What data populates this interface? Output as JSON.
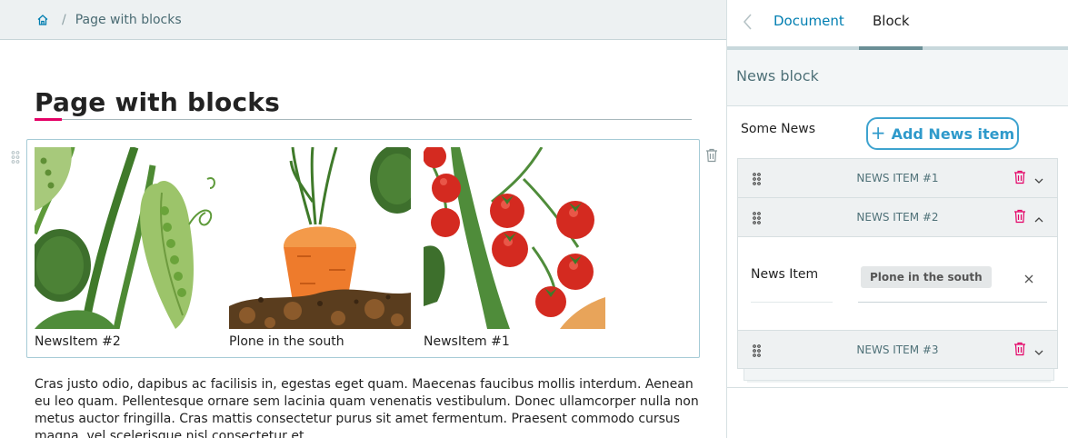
{
  "breadcrumb": {
    "home_icon": "home-icon",
    "separator": "/",
    "current": "Page with blocks"
  },
  "page": {
    "title": "Page with blocks",
    "accent_color": "#e40166",
    "body_text": "Cras justo odio, dapibus ac facilisis in, egestas eget quam. Maecenas faucibus mollis interdum. Aenean eu leo quam. Pellentesque ornare sem lacinia quam venenatis vestibulum. Donec ullamcorper nulla non metus auctor fringilla. Cras mattis consectetur purus sit amet fermentum. Praesent commodo cursus magna, vel scelerisque nisl consectetur et."
  },
  "news_block": {
    "items": [
      {
        "caption": "NewsItem #2",
        "image": "pea-pods-illustration"
      },
      {
        "caption": "Plone in the south",
        "image": "carrot-in-soil-illustration"
      },
      {
        "caption": "NewsItem #1",
        "image": "cherry-tomatoes-illustration"
      }
    ]
  },
  "sidebar": {
    "tabs": [
      {
        "label": "Document",
        "active": false
      },
      {
        "label": "Block",
        "active": true
      }
    ],
    "section_title": "News block",
    "field_label": "Some News",
    "add_button": "Add News item",
    "items": [
      {
        "label": "NEWS ITEM #1",
        "expanded": false
      },
      {
        "label": "NEWS ITEM #2",
        "expanded": true,
        "field_label": "News Item",
        "value": "Plone in the south"
      },
      {
        "label": "NEWS ITEM #3",
        "expanded": false
      }
    ],
    "accent_color": "#3ea3cf",
    "trash_color": "#e40166"
  }
}
